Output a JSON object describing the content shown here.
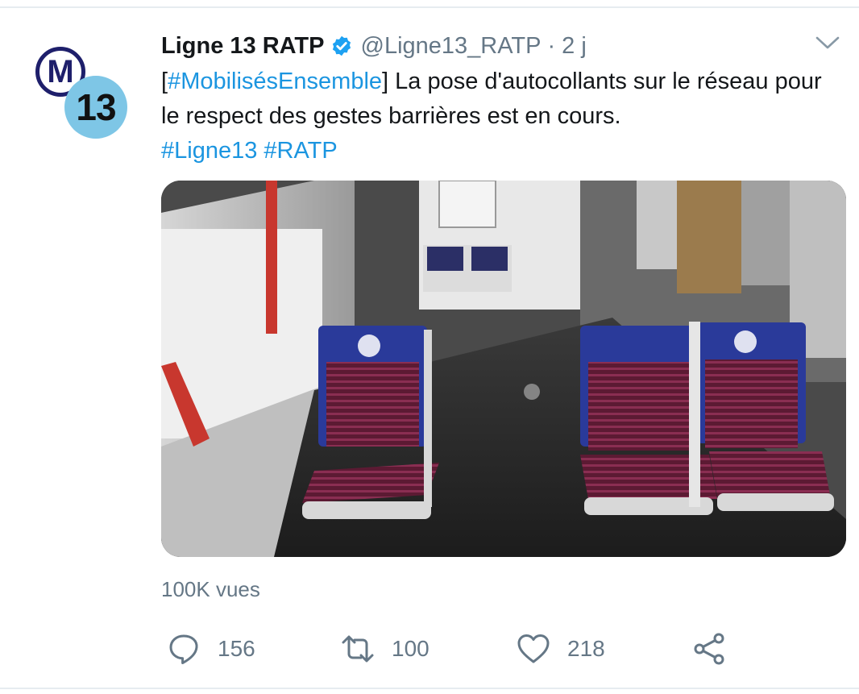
{
  "tweet": {
    "display_name": "Ligne 13 RATP",
    "verified": true,
    "handle": "@Ligne13_RATP",
    "separator": "·",
    "time": "2 j",
    "text_parts": [
      {
        "type": "text",
        "value": "["
      },
      {
        "type": "link",
        "value": "#MobilisésEnsemble"
      },
      {
        "type": "text",
        "value": "] La pose d'autocollants sur le réseau pour le respect des gestes barrières est en cours. "
      },
      {
        "type": "link",
        "value": "#Ligne13"
      },
      {
        "type": "text",
        "value": " "
      },
      {
        "type": "link",
        "value": "#RATP"
      }
    ],
    "avatar": {
      "letter": "M",
      "line_number": "13"
    },
    "views": "100K vues",
    "actions": {
      "reply": {
        "icon": "reply-icon",
        "count": "156"
      },
      "retweet": {
        "icon": "retweet-icon",
        "count": "100"
      },
      "like": {
        "icon": "heart-icon",
        "count": "218"
      },
      "share": {
        "icon": "share-icon"
      }
    }
  },
  "colors": {
    "link": "#1b95e0",
    "secondary_text": "#657786",
    "primary_text": "#14171a",
    "verified_badge": "#1da1f2",
    "avatar_blue": "#1e1f6b",
    "avatar_line_color": "#7ec6e6"
  }
}
